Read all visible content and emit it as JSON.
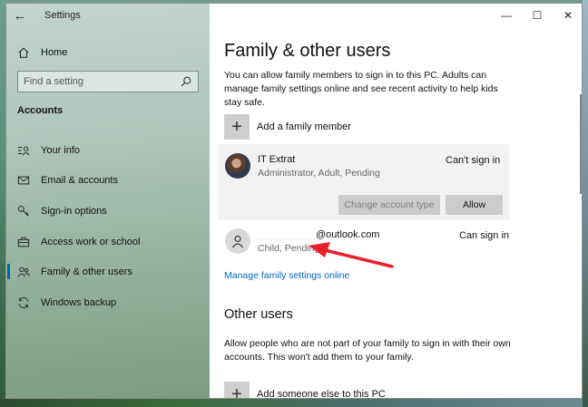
{
  "window": {
    "app_title": "Settings",
    "controls": {
      "minimize": "—",
      "maximize": "☐",
      "close": "✕"
    }
  },
  "sidebar": {
    "back_glyph": "←",
    "home_label": "Home",
    "search_placeholder": "Find a setting",
    "section_label": "Accounts",
    "items": [
      {
        "label": "Your info",
        "icon": "person-card-icon",
        "active": false
      },
      {
        "label": "Email & accounts",
        "icon": "mail-icon",
        "active": false
      },
      {
        "label": "Sign-in options",
        "icon": "key-icon",
        "active": false
      },
      {
        "label": "Access work or school",
        "icon": "briefcase-icon",
        "active": false
      },
      {
        "label": "Family & other users",
        "icon": "people-icon",
        "active": true
      },
      {
        "label": "Windows backup",
        "icon": "sync-icon",
        "active": false
      }
    ]
  },
  "main": {
    "title": "Family & other users",
    "intro": "You can allow family members to sign in to this PC. Adults can manage family settings online and see recent activity to help kids stay safe.",
    "add_family_label": "Add a family member",
    "users": [
      {
        "name": "IT Extrat",
        "sub": "Administrator, Adult, Pending",
        "status": "Can't sign in",
        "change_type_label": "Change account type",
        "allow_label": "Allow"
      },
      {
        "email_suffix": "@outlook.com",
        "sub": "Child, Pending",
        "status": "Can sign in"
      }
    ],
    "manage_link": "Manage family settings online",
    "other_users_heading": "Other users",
    "other_users_text": "Allow people who are not part of your family to sign in with their own accounts. This won't add them to your family.",
    "add_other_label": "Add someone else to this PC"
  },
  "colors": {
    "accent": "#0063b1",
    "link": "#0067c0",
    "annotation_arrow": "#e8202a"
  }
}
